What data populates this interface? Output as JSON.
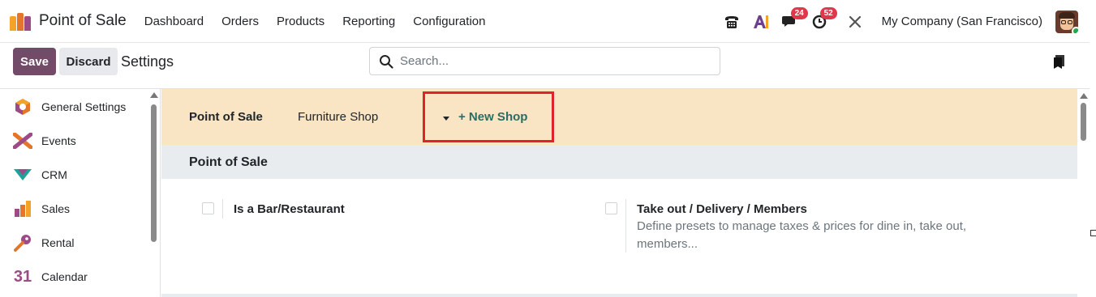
{
  "navbar": {
    "app_title": "Point of Sale",
    "menu": [
      "Dashboard",
      "Orders",
      "Products",
      "Reporting",
      "Configuration"
    ],
    "icons": [
      "phone-icon",
      "ai-icon",
      "chat-icon",
      "activity-clock-icon",
      "debug-tools-icon"
    ],
    "chat_badge": "24",
    "activity_badge": "52",
    "company": "My Company (San Francisco)",
    "brand_colors": [
      "#f3a328",
      "#e3762b",
      "#9c4b87"
    ]
  },
  "control": {
    "save_label": "Save",
    "discard_label": "Discard",
    "breadcrumb": "Settings",
    "search_placeholder": "Search...",
    "save_color": "#714b67"
  },
  "sidebar": {
    "items": [
      {
        "label": "General Settings",
        "icon": "general-settings-icon"
      },
      {
        "label": "Events",
        "icon": "events-icon"
      },
      {
        "label": "CRM",
        "icon": "crm-icon"
      },
      {
        "label": "Sales",
        "icon": "sales-icon"
      },
      {
        "label": "Rental",
        "icon": "rental-icon"
      },
      {
        "label": "Calendar",
        "icon": "calendar-icon",
        "icon_text": "31"
      }
    ]
  },
  "main": {
    "shop_bar": {
      "label": "Point of Sale",
      "selected_shop": "Furniture Shop",
      "new_shop": "+ New Shop",
      "background": "#f9e5c3",
      "highlight_color": "#e0232a"
    },
    "section_title": "Point of Sale",
    "options": [
      {
        "title": "Is a Bar/Restaurant",
        "description": "",
        "checked": false
      },
      {
        "title": "Take out / Delivery / Members",
        "description": "Define presets to manage taxes & prices for dine in, take out, members...",
        "checked": false
      }
    ]
  }
}
